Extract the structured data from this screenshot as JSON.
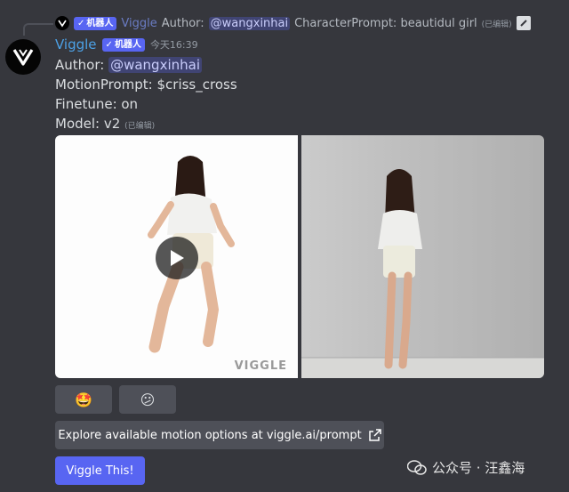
{
  "reply": {
    "author": "Viggle",
    "bot_tag": "机器人",
    "text_before": "Author:",
    "mention": "@wangxinhai",
    "text_after": "CharacterPrompt: beautidul girl",
    "edited": "(已编辑)"
  },
  "message": {
    "username": "Viggle",
    "bot_tag": "机器人",
    "timestamp": "今天16:39",
    "author_label": "Author:",
    "author_mention": "@wangxinhai",
    "motion_prompt": "MotionPrompt: $criss_cross",
    "finetune": "Finetune: on",
    "model": "Model: v2",
    "model_edited": "(已编辑)"
  },
  "media": {
    "watermark": "VIGGLE"
  },
  "reactions": [
    {
      "emoji": "🤩"
    },
    {
      "emoji": "😕"
    }
  ],
  "buttons": {
    "explore": "Explore available motion options at viggle.ai/prompt",
    "viggle_this": "Viggle This!"
  },
  "overlay": {
    "wechat_text": "公众号 · 汪鑫海"
  },
  "colors": {
    "background": "#36373d",
    "username": "#4ca1e6",
    "blurple": "#5865f2",
    "button_gray": "#4e5058"
  }
}
